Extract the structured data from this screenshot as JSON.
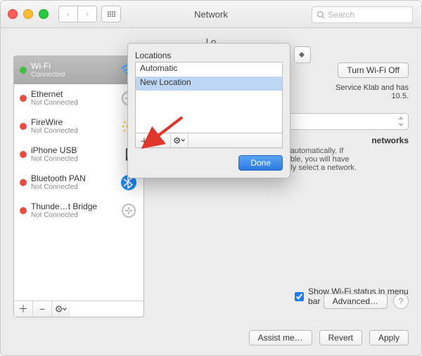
{
  "window": {
    "title": "Network",
    "search_placeholder": "Search"
  },
  "location_label_trunc": "Lo",
  "sidebar": {
    "items": [
      {
        "name": "Wi-Fi",
        "sub": "Connected",
        "status": "green",
        "icon": "wifi",
        "selected": true
      },
      {
        "name": "Ethernet",
        "sub": "Not Connected",
        "status": "red",
        "icon": "ethernet"
      },
      {
        "name": "FireWire",
        "sub": "Not Connected",
        "status": "red",
        "icon": "firewire"
      },
      {
        "name": "iPhone USB",
        "sub": "Not Connected",
        "status": "red",
        "icon": "iphone"
      },
      {
        "name": "Bluetooth PAN",
        "sub": "Not Connected",
        "status": "red",
        "icon": "bluetooth"
      },
      {
        "name": "Thunde…t Bridge",
        "sub": "Not Connected",
        "status": "red",
        "icon": "thunderbolt"
      }
    ]
  },
  "right_panel": {
    "turn_off_label": "Turn Wi-Fi Off",
    "info_line1": "Service Klab and has",
    "info_line2": "10.5.",
    "auto_join_heading": "networks",
    "auto_join_text": "be joined automatically. If\nare available, you will have\nto manually select a network.",
    "show_status_label": "Show Wi-Fi status in menu bar",
    "advanced_label": "Advanced…"
  },
  "buttons": {
    "assist": "Assist me…",
    "revert": "Revert",
    "apply": "Apply"
  },
  "popup": {
    "header": "Locations",
    "items": [
      "Automatic",
      "New Location"
    ],
    "selected_index": 1,
    "done_label": "Done"
  },
  "glyphs": {
    "plus": "＋",
    "minus": "−",
    "gear": "✽⌄",
    "search": "⌕",
    "help": "?",
    "chev_l": "‹",
    "chev_r": "›",
    "updown": "⌃⌄"
  }
}
